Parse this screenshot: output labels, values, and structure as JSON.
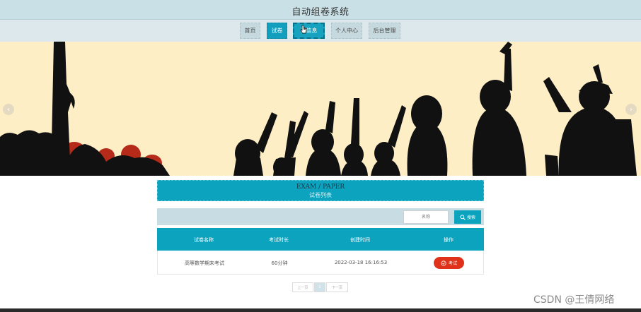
{
  "header": {
    "site_title": "自动组卷系统"
  },
  "nav": {
    "items": [
      {
        "label": "首页"
      },
      {
        "label": "试卷"
      },
      {
        "label": "试信息"
      },
      {
        "label": "个人中心"
      },
      {
        "label": "后台管理"
      }
    ],
    "active_index": 1
  },
  "banner": {
    "prev_glyph": "‹",
    "next_glyph": "›"
  },
  "section": {
    "title_en": "EXAM / PAPER",
    "title_cn": "试卷列表"
  },
  "search": {
    "placeholder": "名称",
    "button_label": "搜索"
  },
  "table": {
    "columns": [
      "试卷名称",
      "考试时长",
      "创建时间",
      "操作"
    ],
    "rows": [
      {
        "name": "高等数学期末考试",
        "duration": "60分钟",
        "created": "2022-03-18 16:16:53",
        "action": "考试"
      }
    ]
  },
  "pagination": {
    "prev": "上一页",
    "current": "1",
    "next": "下一页"
  },
  "watermark": "CSDN @王倩网络",
  "colors": {
    "accent": "#0ca3bf",
    "danger": "#e0321a",
    "banner_bg": "#fdeec5"
  }
}
